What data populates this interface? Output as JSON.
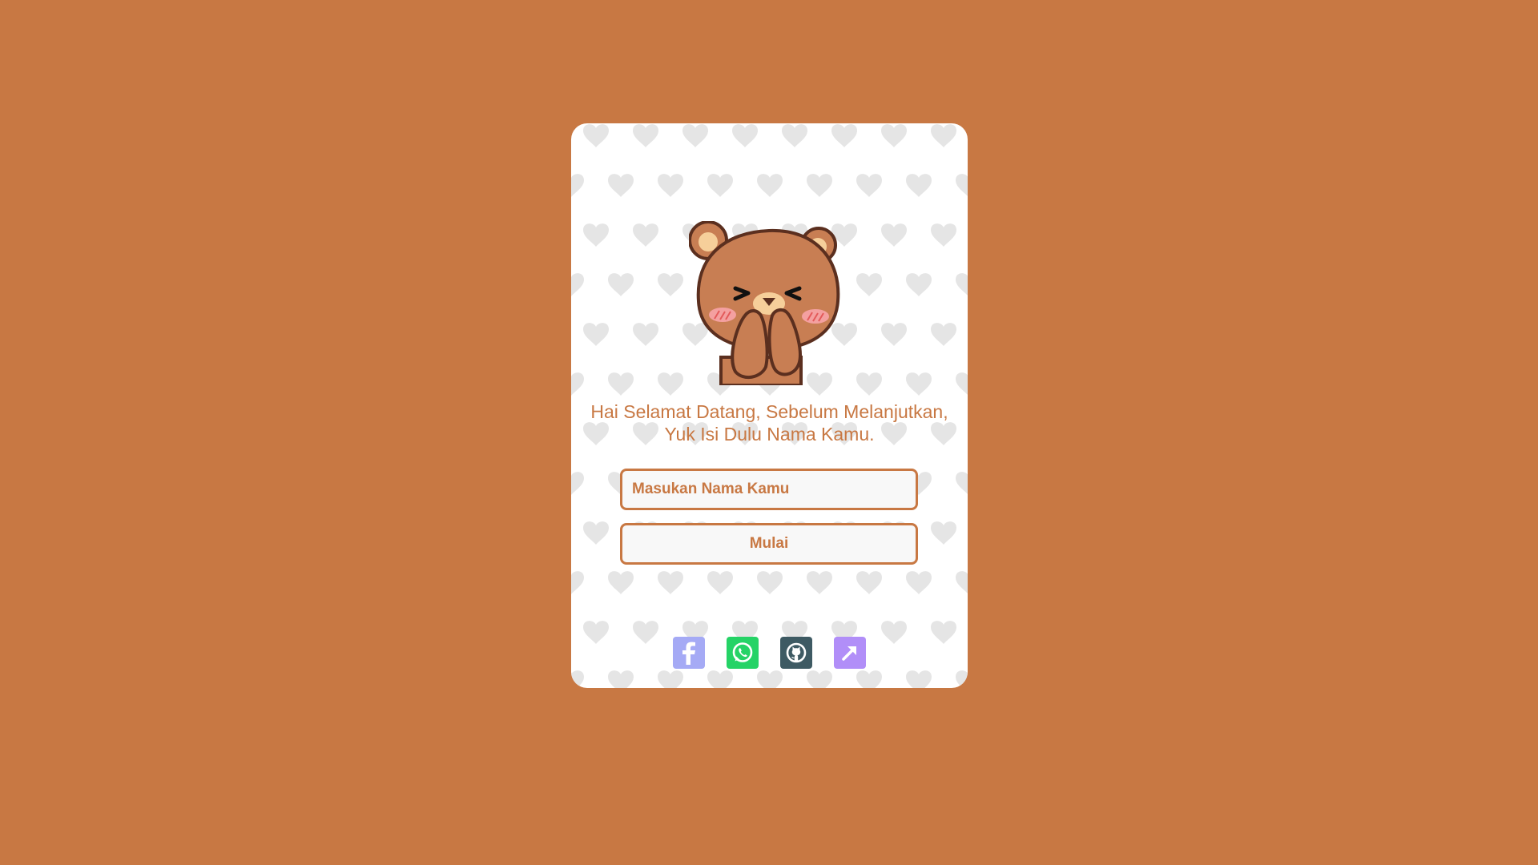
{
  "page": {
    "background_color": "#c87843",
    "accent_color": "#c87843"
  },
  "card": {
    "greeting": "Hai Selamat Datang, Sebelum Melanjutkan, Yuk Isi Dulu Nama Kamu.",
    "illustration": "bear-covering-mouth-icon"
  },
  "form": {
    "name_placeholder": "Masukan Nama Kamu",
    "name_value": "",
    "start_label": "Mulai"
  },
  "socials": [
    {
      "icon": "facebook-icon",
      "color": "#a5aaf5"
    },
    {
      "icon": "whatsapp-icon",
      "color": "#25d366"
    },
    {
      "icon": "github-icon",
      "color": "#3e5a63"
    },
    {
      "icon": "external-link-icon",
      "color": "#b18ef8"
    }
  ]
}
